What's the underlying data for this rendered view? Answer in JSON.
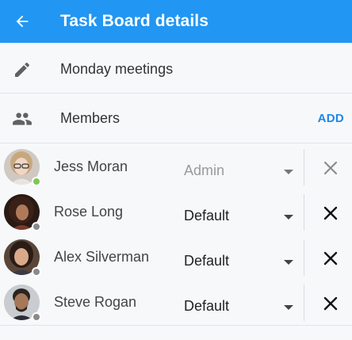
{
  "appbar": {
    "title": "Task Board details",
    "back_icon": "arrow-left-icon",
    "background": "#2196f3"
  },
  "board": {
    "name": "Monday meetings",
    "icon": "pencil-icon"
  },
  "members_section": {
    "label": "Members",
    "icon": "group-icon",
    "add_label": "ADD",
    "accent": "#1e88e5"
  },
  "members": [
    {
      "name": "Jess Moran",
      "role": "Admin",
      "role_editable": false,
      "status": "online",
      "status_color": "#7dc852",
      "removable": false
    },
    {
      "name": "Rose Long",
      "role": "Default",
      "role_editable": true,
      "status": "offline",
      "status_color": "#8a8a8a",
      "removable": true
    },
    {
      "name": "Alex Silverman",
      "role": "Default",
      "role_editable": true,
      "status": "offline",
      "status_color": "#8a8a8a",
      "removable": true
    },
    {
      "name": "Steve Rogan",
      "role": "Default",
      "role_editable": true,
      "status": "offline",
      "status_color": "#8a8a8a",
      "removable": true
    }
  ]
}
